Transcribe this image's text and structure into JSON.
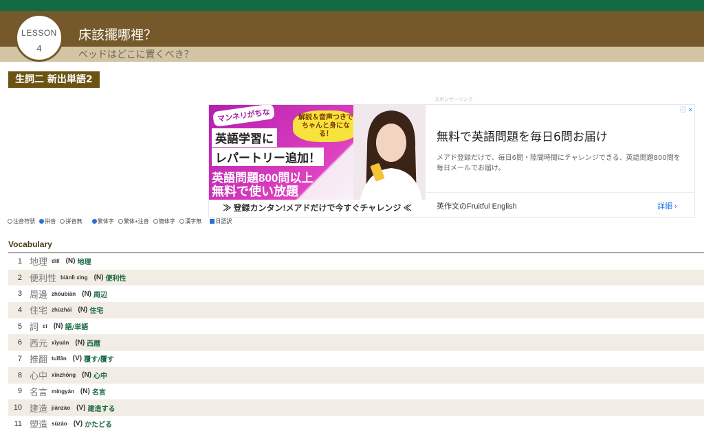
{
  "header": {
    "lesson_label": "LESSON",
    "lesson_number": "4",
    "title_zh": "床該擺哪裡？",
    "title_ja": "ベッドはどこに置くべき？"
  },
  "section": {
    "label": "生詞二 新出単語2"
  },
  "ad": {
    "sponsor": "スポンサーリンク",
    "image": {
      "bubble": "マンネリがちな",
      "bubble2": "解説＆音声つきでちゃんと身になる！",
      "line1": "英語学習に",
      "line2": "レパートリー追加！",
      "line3": "英語問題800問以上",
      "line4": "無料で使い放題",
      "cta": "≫ 登録カンタン!メアドだけで今すぐチャレンジ ≪"
    },
    "title": "無料で英語問題を毎日6問お届け",
    "description": "メアド登録だけで、毎日6問・隙間時間にチャレンジできる、英語問題800問を毎日メールでお届け。",
    "brand": "英作文のFruitful English",
    "more": "詳細 ›"
  },
  "options": [
    {
      "label": "注音符號",
      "type": "radio",
      "checked": false
    },
    {
      "label": "拼音",
      "type": "radio",
      "checked": true
    },
    {
      "label": "拼音無",
      "type": "radio",
      "checked": false
    },
    {
      "label": "繁体字",
      "type": "radio",
      "checked": true
    },
    {
      "label": "繁体+注音",
      "type": "radio",
      "checked": false
    },
    {
      "label": "簡体字",
      "type": "radio",
      "checked": false
    },
    {
      "label": "漢字無",
      "type": "radio",
      "checked": false
    },
    {
      "label": "日語訳",
      "type": "checkbox",
      "checked": true
    }
  ],
  "vocab": {
    "heading": "Vocabulary",
    "items": [
      {
        "num": "1",
        "hanzi": "地理",
        "pinyin": "dìlǐ",
        "pos": "(N)",
        "meaning": "地理"
      },
      {
        "num": "2",
        "hanzi": "便利性",
        "pinyin": "biànlì xìng",
        "pos": "(N)",
        "meaning": "便利性"
      },
      {
        "num": "3",
        "hanzi": "周邊",
        "pinyin": "zhōubiān",
        "pos": "(N)",
        "meaning": "周辺"
      },
      {
        "num": "4",
        "hanzi": "住宅",
        "pinyin": "zhùzhái",
        "pos": "(N)",
        "meaning": "住宅"
      },
      {
        "num": "5",
        "hanzi": "詞",
        "pinyin": "cí",
        "pos": "(N)",
        "meaning": "語/単語"
      },
      {
        "num": "6",
        "hanzi": "西元",
        "pinyin": "xīyuán",
        "pos": "(N)",
        "meaning": "西暦"
      },
      {
        "num": "7",
        "hanzi": "推翻",
        "pinyin": "tuīfān",
        "pos": "(V)",
        "meaning": "覆す/覆す"
      },
      {
        "num": "8",
        "hanzi": "心中",
        "pinyin": "xīnzhōng",
        "pos": "(N)",
        "meaning": "心中"
      },
      {
        "num": "9",
        "hanzi": "名言",
        "pinyin": "míngyán",
        "pos": "(N)",
        "meaning": "名言"
      },
      {
        "num": "10",
        "hanzi": "建造",
        "pinyin": "jiànzào",
        "pos": "(V)",
        "meaning": "建造する"
      },
      {
        "num": "11",
        "hanzi": "塑造",
        "pinyin": "sùzào",
        "pos": "(V)",
        "meaning": "かたどる"
      }
    ]
  },
  "colors": {
    "topbar": "#126b45",
    "header": "#75592a",
    "subheader": "#d3c5a4",
    "section": "#6b5313",
    "meaning": "#1a6a40"
  }
}
